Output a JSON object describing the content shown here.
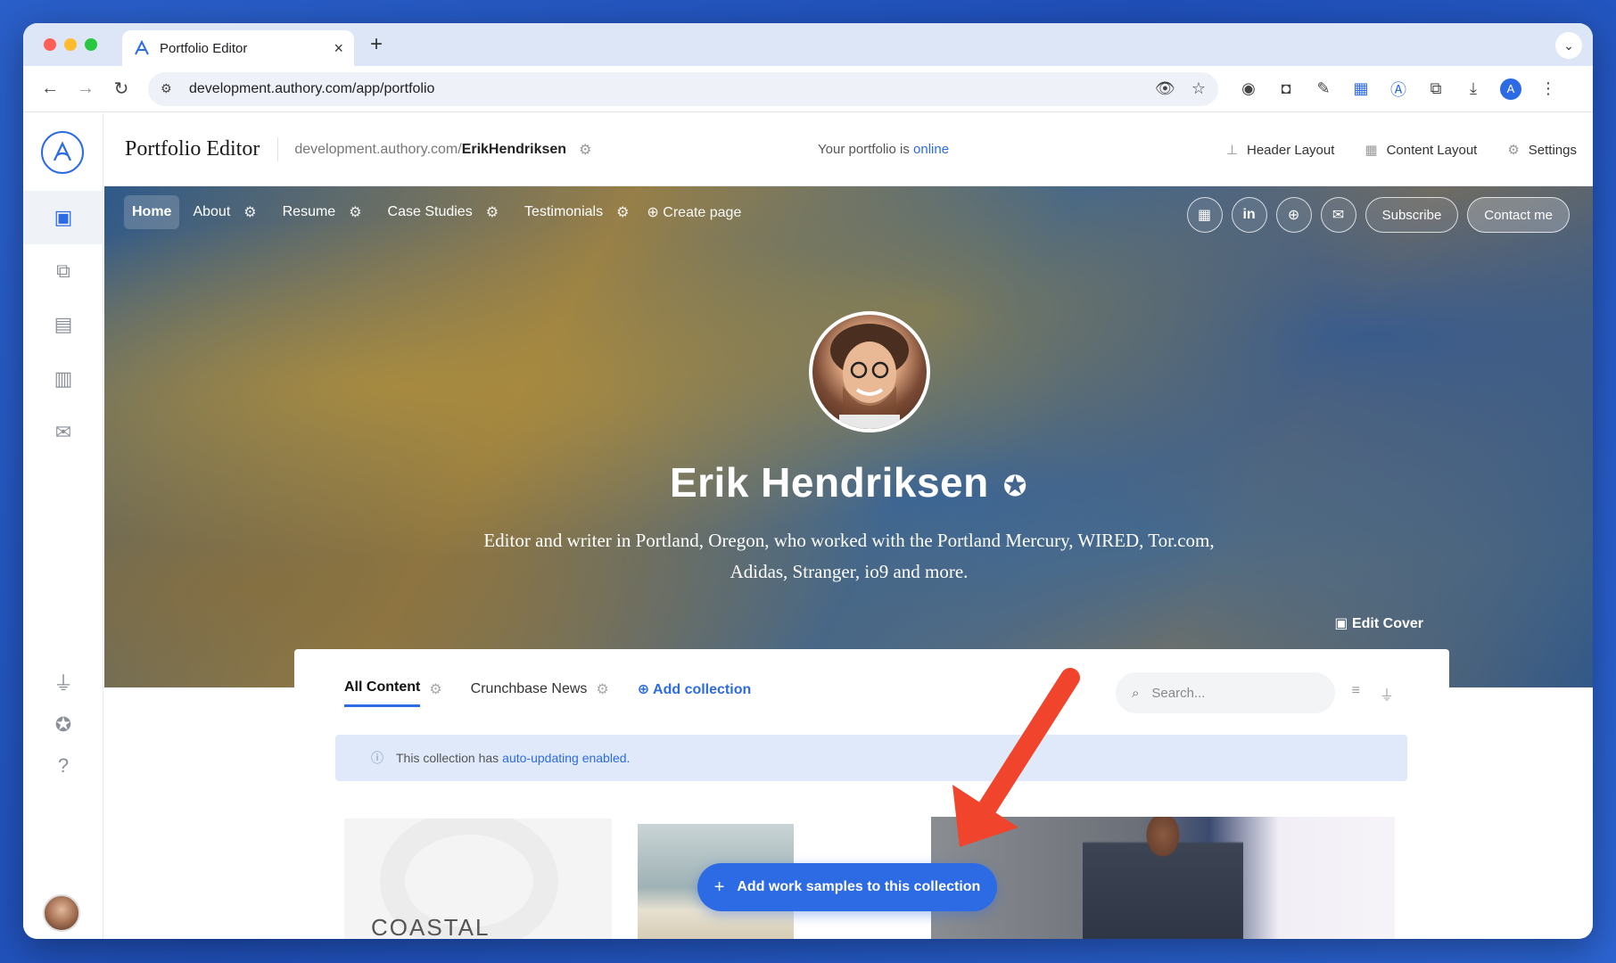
{
  "browser": {
    "tab_title": "Portfolio Editor",
    "url": "development.authory.com/app/portfolio"
  },
  "editor": {
    "title": "Portfolio Editor",
    "portfolio_url_prefix": "development.authory.com/",
    "portfolio_url_user": "ErikHendriksen",
    "status_prefix": "Your portfolio is",
    "status_value": "online",
    "actions": [
      {
        "label": "Header Layout",
        "icon": "header-layout-icon"
      },
      {
        "label": "Content Layout",
        "icon": "content-layout-icon"
      },
      {
        "label": "Settings",
        "icon": "gear-icon"
      }
    ]
  },
  "nav": {
    "pages": [
      "Home",
      "About",
      "Resume",
      "Case Studies",
      "Testimonials"
    ],
    "create_page": "Create page",
    "subscribe": "Subscribe",
    "contact": "Contact me",
    "social_icons": [
      "calendar-icon",
      "linkedin-icon",
      "globe-icon",
      "mail-icon"
    ]
  },
  "hero": {
    "name": "Erik Hendriksen",
    "bio": "Editor and writer in Portland, Oregon, who worked with the Portland Mercury, WIRED, Tor.com, Adidas, Stranger, io9 and more.",
    "edit_cover": "Edit Cover"
  },
  "collections": {
    "tabs": [
      "All Content",
      "Crunchbase News"
    ],
    "add_collection": "Add collection",
    "search_placeholder": "Search...",
    "info_text": "This collection has",
    "info_link": "auto-updating enabled.",
    "add_samples": "Add work samples to this collection",
    "thumb_text": "COASTAL MARKETING"
  },
  "colors": {
    "accent": "#2d6be4",
    "arrow": "#f0442c",
    "banner": "#dfe9f9"
  }
}
